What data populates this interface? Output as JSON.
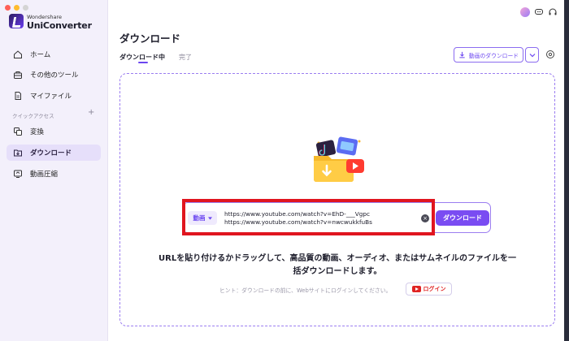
{
  "app": {
    "brand_small": "Wondershare",
    "brand_name": "UniConverter"
  },
  "sidebar": {
    "items": [
      {
        "label": "ホーム",
        "icon": "home-icon"
      },
      {
        "label": "その他のツール",
        "icon": "toolbox-icon"
      },
      {
        "label": "マイファイル",
        "icon": "file-icon"
      }
    ],
    "section_label": "クイックアクセス",
    "section_add": "+",
    "quick_items": [
      {
        "label": "変換",
        "icon": "convert-icon"
      },
      {
        "label": "ダウンロード",
        "icon": "download-folder-icon",
        "active": true
      },
      {
        "label": "動画圧縮",
        "icon": "compress-icon"
      }
    ]
  },
  "main": {
    "title": "ダウンロード",
    "tabs": [
      {
        "label": "ダウンロード中",
        "active": true
      },
      {
        "label": "完了",
        "active": false
      }
    ],
    "download_video_button": "動画のダウンロード",
    "url_input": {
      "type_label": "動画",
      "urls": [
        "https://www.youtube.com/watch?v=EhD-___Vgpc",
        "https://www.youtube.com/watch?v=nwcwukkfuBs"
      ],
      "clear_symbol": "×"
    },
    "download_button": "ダウンロード",
    "description_line1": "URLを貼り付けるかドラッグして、高品質の動画、オーディオ、またはサムネイルのファイルを一",
    "description_line2": "括ダウンロードします。",
    "hint": "ヒント：ダウンロードの前に、Webサイトにログインしてください。",
    "login_button": "ログイン"
  },
  "colors": {
    "accent": "#7a4cf2",
    "highlight_box": "#e0151f",
    "sidebar_bg": "#f3f0fb",
    "youtube_red": "#e02424"
  }
}
